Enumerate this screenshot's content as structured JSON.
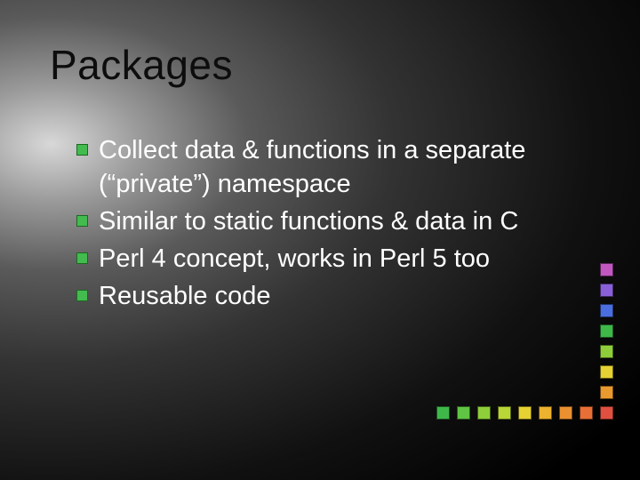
{
  "slide": {
    "title": "Packages",
    "bullets": [
      "Collect data & functions in a separate (“private”) namespace",
      "Similar to static functions & data in C",
      "Perl 4 concept, works in Perl 5 too",
      "Reusable code"
    ]
  }
}
